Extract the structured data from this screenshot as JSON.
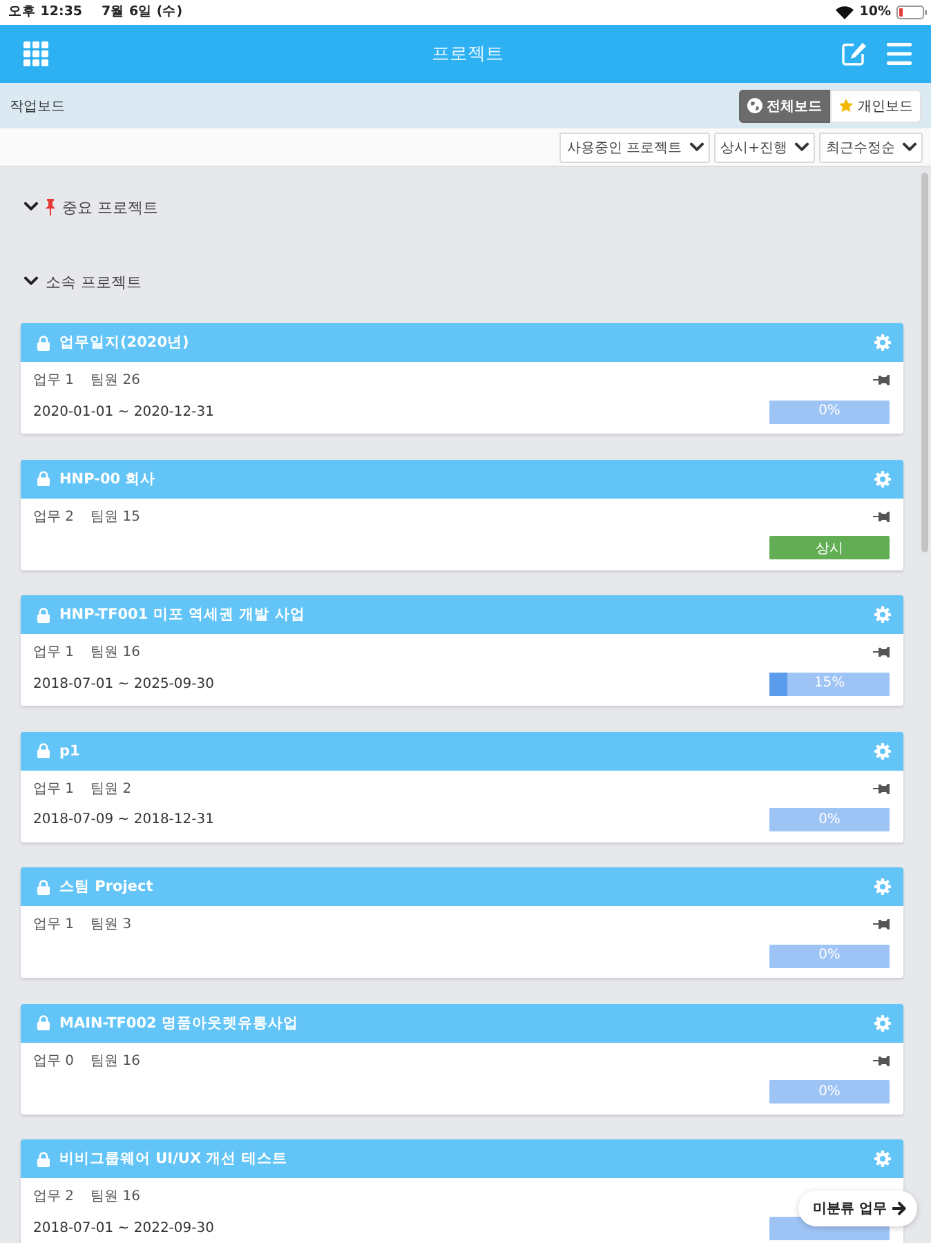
{
  "status_bar": {
    "time": "오후 12:35",
    "date": "7월 6일 (수)",
    "battery": "10%"
  },
  "header": {
    "title": "프로젝트"
  },
  "board_bar": {
    "title": "작업보드",
    "tabs": [
      {
        "label": "전체보드",
        "kind": "all",
        "selected": true
      },
      {
        "label": "개인보드",
        "kind": "personal",
        "selected": false
      }
    ]
  },
  "filters": [
    {
      "label": "사용중인 프로젝트"
    },
    {
      "label": "상시+진행"
    },
    {
      "label": "최근수정순"
    }
  ],
  "sections": [
    {
      "title": "중요 프로젝트",
      "expanded": true,
      "pinned": true
    },
    {
      "title": "소속 프로젝트",
      "expanded": true,
      "pinned": false,
      "projects": [
        {
          "title": "업무일지(2020년)",
          "locked": true,
          "tasks": "업무 1",
          "members": "팀원 26",
          "period": "2020-01-01 ~ 2020-12-31",
          "progress": {
            "kind": "percent",
            "level": 0,
            "reading": "0%"
          }
        },
        {
          "title": "HNP-00 회사",
          "locked": true,
          "tasks": "업무 2",
          "members": "팀원 15",
          "progress": {
            "kind": "status",
            "reading": "상시"
          }
        },
        {
          "title": "HNP-TF001 미포 역세권 개발 사업",
          "locked": true,
          "tasks": "업무 1",
          "members": "팀원 16",
          "period": "2018-07-01 ~ 2025-09-30",
          "progress": {
            "kind": "percent",
            "level": 0.15,
            "reading": "15%"
          }
        },
        {
          "title": "p1",
          "locked": true,
          "tasks": "업무 1",
          "members": "팀원 2",
          "period": "2018-07-09 ~ 2018-12-31",
          "progress": {
            "kind": "percent",
            "level": 0,
            "reading": "0%"
          }
        },
        {
          "title": "스팀 Project",
          "locked": true,
          "tasks": "업무 1",
          "members": "팀원 3",
          "progress": {
            "kind": "percent",
            "level": 0,
            "reading": "0%"
          }
        },
        {
          "title": "MAIN-TF002 명품아웃렛유통사업",
          "locked": true,
          "tasks": "업무 0",
          "members": "팀원 16",
          "progress": {
            "kind": "percent",
            "level": 0,
            "reading": "0%"
          }
        },
        {
          "title": "비비그룹웨어 UI/UX 개선 테스트",
          "locked": true,
          "tasks": "업무 2",
          "members": "팀원 16",
          "period": "2018-07-01 ~ 2022-09-30",
          "progress": {
            "kind": "percent",
            "level": 0
          }
        }
      ]
    }
  ],
  "floating_button": {
    "label": "미분류 업무"
  }
}
